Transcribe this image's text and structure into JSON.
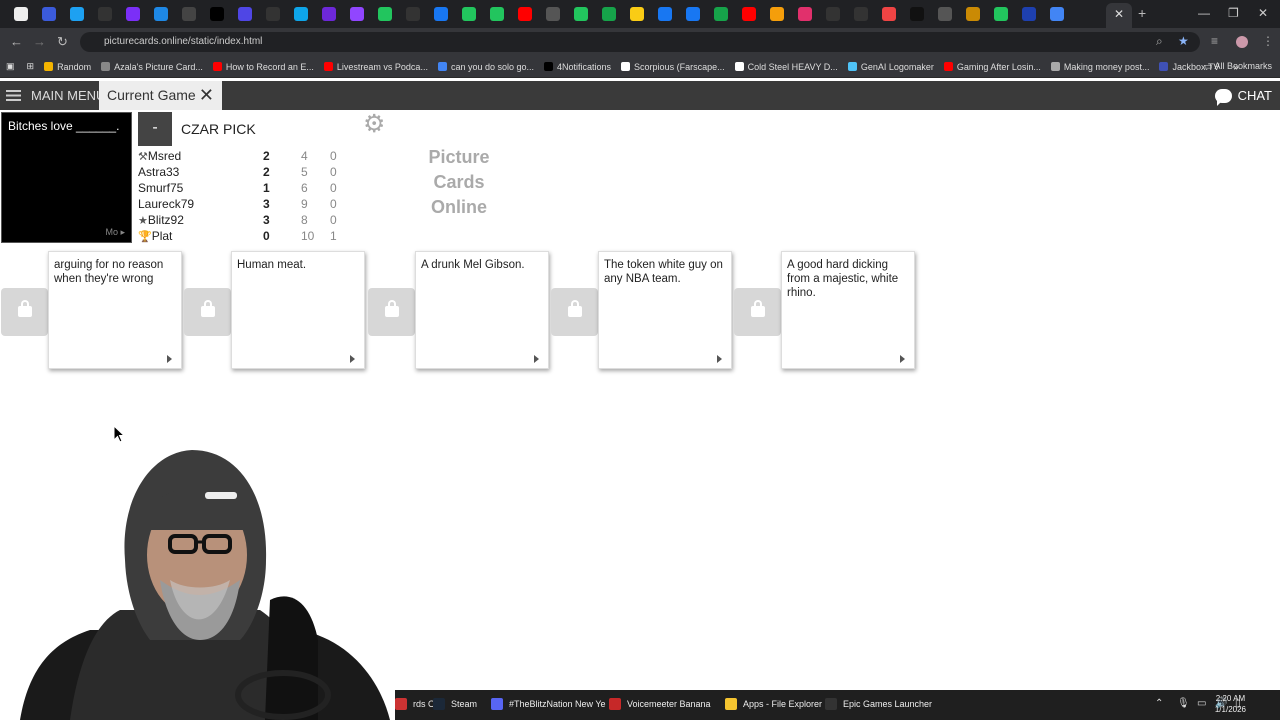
{
  "browser": {
    "url": "picturecards.online/static/index.html",
    "active_tab_close": "✕",
    "new_tab": "+",
    "bookmarks": [
      {
        "label": "Random",
        "color": "#f4b400"
      },
      {
        "label": "Azala's Picture Card...",
        "color": "#888"
      },
      {
        "label": "How to Record an E...",
        "color": "#ff0000"
      },
      {
        "label": "Livestream vs Podca...",
        "color": "#ff0000"
      },
      {
        "label": "can you do solo go...",
        "color": "#4285f4"
      },
      {
        "label": "4Notifications",
        "color": "#000"
      },
      {
        "label": "Scorpious (Farscape...",
        "color": "#fff"
      },
      {
        "label": "Cold Steel HEAVY D...",
        "color": "#fff"
      },
      {
        "label": "GenAI Logomaker",
        "color": "#4fc3f7"
      },
      {
        "label": "Gaming After Losin...",
        "color": "#ff0000"
      },
      {
        "label": "Making money post...",
        "color": "#aaa"
      },
      {
        "label": "Jackbox.TV",
        "color": "#3f51b5"
      }
    ],
    "all_bookmarks": "All Bookmarks"
  },
  "appbar": {
    "main_menu": "MAIN MENU",
    "current_tab": "Current Game",
    "tab_close": "✕",
    "chat": "CHAT"
  },
  "game": {
    "black_card": "Bitches love ______.",
    "black_card_more": "Mo",
    "minus_label": "-",
    "status": "CZAR PICK",
    "brand_line1": "Picture",
    "brand_line2": "Cards",
    "brand_line3": "Online",
    "players": [
      {
        "icon": "⚒",
        "name": "Msred",
        "score": "2",
        "hand": "4",
        "idle": "0"
      },
      {
        "icon": "",
        "name": "Astra33",
        "score": "2",
        "hand": "5",
        "idle": "0"
      },
      {
        "icon": "",
        "name": "Smurf75",
        "score": "1",
        "hand": "6",
        "idle": "0"
      },
      {
        "icon": "",
        "name": "Laureck79",
        "score": "3",
        "hand": "9",
        "idle": "0"
      },
      {
        "icon": "★",
        "name": "Blitz92",
        "score": "3",
        "hand": "8",
        "idle": "0"
      },
      {
        "icon": "🏆",
        "name": "Plat",
        "score": "0",
        "hand": "10",
        "idle": "1"
      }
    ],
    "white_cards": [
      "arguing for no reason when they're wrong",
      "Human meat.",
      "A drunk Mel Gibson.",
      "The token white guy on any NBA team.",
      "A good hard dicking from a majestic, white rhino."
    ]
  },
  "taskbar": {
    "items": [
      {
        "label": "rds Or",
        "color": "#c33"
      },
      {
        "label": "Steam",
        "color": "#1b2838"
      },
      {
        "label": "#TheBlitzNation New Ye",
        "color": "#5865f2"
      },
      {
        "label": "Voicemeeter Banana",
        "color": "#c62828"
      },
      {
        "label": "Apps - File Explorer",
        "color": "#f4c430"
      },
      {
        "label": "Epic Games Launcher",
        "color": "#333"
      }
    ],
    "time": "2:20 AM",
    "date": "1/1/2026"
  }
}
